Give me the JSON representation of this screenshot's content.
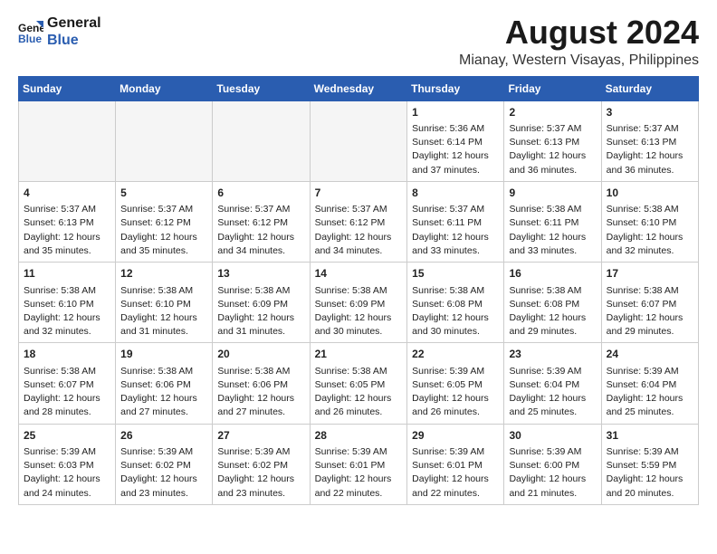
{
  "header": {
    "logo_line1": "General",
    "logo_line2": "Blue",
    "main_title": "August 2024",
    "subtitle": "Mianay, Western Visayas, Philippines"
  },
  "calendar": {
    "days_of_week": [
      "Sunday",
      "Monday",
      "Tuesday",
      "Wednesday",
      "Thursday",
      "Friday",
      "Saturday"
    ],
    "weeks": [
      [
        {
          "day": "",
          "info": "",
          "empty": true
        },
        {
          "day": "",
          "info": "",
          "empty": true
        },
        {
          "day": "",
          "info": "",
          "empty": true
        },
        {
          "day": "",
          "info": "",
          "empty": true
        },
        {
          "day": "1",
          "info": "Sunrise: 5:36 AM\nSunset: 6:14 PM\nDaylight: 12 hours\nand 37 minutes."
        },
        {
          "day": "2",
          "info": "Sunrise: 5:37 AM\nSunset: 6:13 PM\nDaylight: 12 hours\nand 36 minutes."
        },
        {
          "day": "3",
          "info": "Sunrise: 5:37 AM\nSunset: 6:13 PM\nDaylight: 12 hours\nand 36 minutes."
        }
      ],
      [
        {
          "day": "4",
          "info": "Sunrise: 5:37 AM\nSunset: 6:13 PM\nDaylight: 12 hours\nand 35 minutes."
        },
        {
          "day": "5",
          "info": "Sunrise: 5:37 AM\nSunset: 6:12 PM\nDaylight: 12 hours\nand 35 minutes."
        },
        {
          "day": "6",
          "info": "Sunrise: 5:37 AM\nSunset: 6:12 PM\nDaylight: 12 hours\nand 34 minutes."
        },
        {
          "day": "7",
          "info": "Sunrise: 5:37 AM\nSunset: 6:12 PM\nDaylight: 12 hours\nand 34 minutes."
        },
        {
          "day": "8",
          "info": "Sunrise: 5:37 AM\nSunset: 6:11 PM\nDaylight: 12 hours\nand 33 minutes."
        },
        {
          "day": "9",
          "info": "Sunrise: 5:38 AM\nSunset: 6:11 PM\nDaylight: 12 hours\nand 33 minutes."
        },
        {
          "day": "10",
          "info": "Sunrise: 5:38 AM\nSunset: 6:10 PM\nDaylight: 12 hours\nand 32 minutes."
        }
      ],
      [
        {
          "day": "11",
          "info": "Sunrise: 5:38 AM\nSunset: 6:10 PM\nDaylight: 12 hours\nand 32 minutes."
        },
        {
          "day": "12",
          "info": "Sunrise: 5:38 AM\nSunset: 6:10 PM\nDaylight: 12 hours\nand 31 minutes."
        },
        {
          "day": "13",
          "info": "Sunrise: 5:38 AM\nSunset: 6:09 PM\nDaylight: 12 hours\nand 31 minutes."
        },
        {
          "day": "14",
          "info": "Sunrise: 5:38 AM\nSunset: 6:09 PM\nDaylight: 12 hours\nand 30 minutes."
        },
        {
          "day": "15",
          "info": "Sunrise: 5:38 AM\nSunset: 6:08 PM\nDaylight: 12 hours\nand 30 minutes."
        },
        {
          "day": "16",
          "info": "Sunrise: 5:38 AM\nSunset: 6:08 PM\nDaylight: 12 hours\nand 29 minutes."
        },
        {
          "day": "17",
          "info": "Sunrise: 5:38 AM\nSunset: 6:07 PM\nDaylight: 12 hours\nand 29 minutes."
        }
      ],
      [
        {
          "day": "18",
          "info": "Sunrise: 5:38 AM\nSunset: 6:07 PM\nDaylight: 12 hours\nand 28 minutes."
        },
        {
          "day": "19",
          "info": "Sunrise: 5:38 AM\nSunset: 6:06 PM\nDaylight: 12 hours\nand 27 minutes."
        },
        {
          "day": "20",
          "info": "Sunrise: 5:38 AM\nSunset: 6:06 PM\nDaylight: 12 hours\nand 27 minutes."
        },
        {
          "day": "21",
          "info": "Sunrise: 5:38 AM\nSunset: 6:05 PM\nDaylight: 12 hours\nand 26 minutes."
        },
        {
          "day": "22",
          "info": "Sunrise: 5:39 AM\nSunset: 6:05 PM\nDaylight: 12 hours\nand 26 minutes."
        },
        {
          "day": "23",
          "info": "Sunrise: 5:39 AM\nSunset: 6:04 PM\nDaylight: 12 hours\nand 25 minutes."
        },
        {
          "day": "24",
          "info": "Sunrise: 5:39 AM\nSunset: 6:04 PM\nDaylight: 12 hours\nand 25 minutes."
        }
      ],
      [
        {
          "day": "25",
          "info": "Sunrise: 5:39 AM\nSunset: 6:03 PM\nDaylight: 12 hours\nand 24 minutes."
        },
        {
          "day": "26",
          "info": "Sunrise: 5:39 AM\nSunset: 6:02 PM\nDaylight: 12 hours\nand 23 minutes."
        },
        {
          "day": "27",
          "info": "Sunrise: 5:39 AM\nSunset: 6:02 PM\nDaylight: 12 hours\nand 23 minutes."
        },
        {
          "day": "28",
          "info": "Sunrise: 5:39 AM\nSunset: 6:01 PM\nDaylight: 12 hours\nand 22 minutes."
        },
        {
          "day": "29",
          "info": "Sunrise: 5:39 AM\nSunset: 6:01 PM\nDaylight: 12 hours\nand 22 minutes."
        },
        {
          "day": "30",
          "info": "Sunrise: 5:39 AM\nSunset: 6:00 PM\nDaylight: 12 hours\nand 21 minutes."
        },
        {
          "day": "31",
          "info": "Sunrise: 5:39 AM\nSunset: 5:59 PM\nDaylight: 12 hours\nand 20 minutes."
        }
      ]
    ]
  }
}
